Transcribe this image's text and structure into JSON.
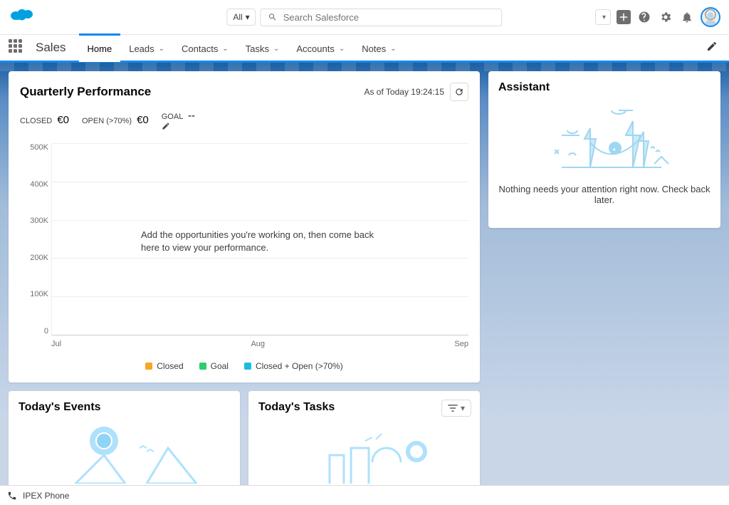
{
  "header": {
    "search_scope": "All",
    "search_placeholder": "Search Salesforce"
  },
  "nav": {
    "app_name": "Sales",
    "tabs": [
      {
        "label": "Home",
        "has_chevron": false,
        "active": true
      },
      {
        "label": "Leads",
        "has_chevron": true,
        "active": false
      },
      {
        "label": "Contacts",
        "has_chevron": true,
        "active": false
      },
      {
        "label": "Tasks",
        "has_chevron": true,
        "active": false
      },
      {
        "label": "Accounts",
        "has_chevron": true,
        "active": false
      },
      {
        "label": "Notes",
        "has_chevron": true,
        "active": false
      }
    ]
  },
  "quarterly_performance": {
    "title": "Quarterly Performance",
    "as_of_label": "As of Today 19:24:15",
    "metrics": {
      "closed_label": "CLOSED",
      "closed_value": "€0",
      "open_label": "OPEN (>70%)",
      "open_value": "€0",
      "goal_label": "GOAL",
      "goal_value": "--"
    },
    "empty_message": "Add the opportunities you're working on, then come back here to view your performance.",
    "legend": {
      "closed": {
        "label": "Closed",
        "color": "#f5a623"
      },
      "goal": {
        "label": "Goal",
        "color": "#2ecc71"
      },
      "closed_open": {
        "label": "Closed + Open (>70%)",
        "color": "#1fbce1"
      }
    }
  },
  "chart_data": {
    "type": "line",
    "categories": [
      "Jul",
      "Aug",
      "Sep"
    ],
    "series": [
      {
        "name": "Closed",
        "values": [
          0,
          0,
          0
        ]
      },
      {
        "name": "Goal",
        "values": [
          null,
          null,
          null
        ]
      },
      {
        "name": "Closed + Open (>70%)",
        "values": [
          0,
          0,
          0
        ]
      }
    ],
    "y_ticks": [
      "500K",
      "400K",
      "300K",
      "200K",
      "100K",
      "0"
    ],
    "ylim": [
      0,
      500000
    ],
    "title": "Quarterly Performance",
    "ylabel": "",
    "xlabel": ""
  },
  "events_card": {
    "title": "Today's Events"
  },
  "tasks_card": {
    "title": "Today's Tasks"
  },
  "assistant": {
    "title": "Assistant",
    "message": "Nothing needs your attention right now. Check back later."
  },
  "phone_bar": {
    "label": "IPEX Phone"
  }
}
